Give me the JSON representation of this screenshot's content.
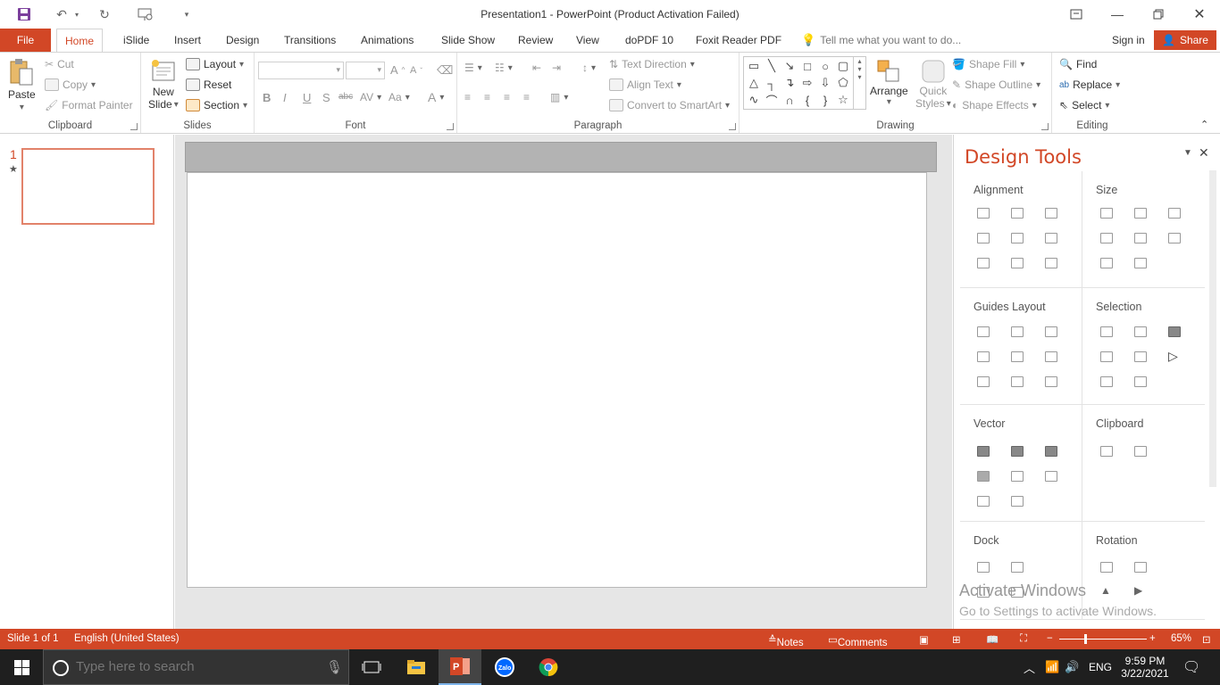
{
  "window": {
    "title": "Presentation1 - PowerPoint (Product Activation Failed)"
  },
  "tabs": {
    "file": "File",
    "items": [
      "Home",
      "iSlide",
      "Insert",
      "Design",
      "Transitions",
      "Animations",
      "Slide Show",
      "Review",
      "View",
      "doPDF 10",
      "Foxit Reader PDF"
    ],
    "tell_me": "Tell me what you want to do...",
    "sign_in": "Sign in",
    "share": "Share"
  },
  "ribbon": {
    "clipboard": {
      "label": "Clipboard",
      "paste": "Paste",
      "cut": "Cut",
      "copy": "Copy",
      "format_painter": "Format Painter"
    },
    "slides": {
      "label": "Slides",
      "new_slide_1": "New",
      "new_slide_2": "Slide",
      "layout": "Layout",
      "reset": "Reset",
      "section": "Section"
    },
    "font": {
      "label": "Font"
    },
    "paragraph": {
      "label": "Paragraph",
      "text_direction": "Text Direction",
      "align_text": "Align Text",
      "convert_smartart": "Convert to SmartArt"
    },
    "drawing": {
      "label": "Drawing",
      "arrange": "Arrange",
      "quick_styles_1": "Quick",
      "quick_styles_2": "Styles",
      "shape_fill": "Shape Fill",
      "shape_outline": "Shape Outline",
      "shape_effects": "Shape Effects"
    },
    "editing": {
      "label": "Editing",
      "find": "Find",
      "replace": "Replace",
      "select": "Select"
    }
  },
  "thumbnails": {
    "slide_number": "1"
  },
  "design_tools": {
    "title": "Design Tools",
    "sections": {
      "alignment": "Alignment",
      "size": "Size",
      "guides_layout": "Guides Layout",
      "selection": "Selection",
      "vector": "Vector",
      "clipboard": "Clipboard",
      "dock": "Dock",
      "rotation": "Rotation"
    }
  },
  "watermark": {
    "line1": "Activate Windows",
    "line2": "Go to Settings to activate Windows."
  },
  "statusbar": {
    "slide_info": "Slide 1 of 1",
    "language": "English (United States)",
    "notes": "Notes",
    "comments": "Comments",
    "zoom": "65%"
  },
  "taskbar": {
    "search_placeholder": "Type here to search",
    "language": "ENG",
    "time": "9:59 PM",
    "date": "3/22/2021"
  },
  "colors": {
    "accent": "#d24726",
    "taskbar": "#1f1f1f"
  }
}
